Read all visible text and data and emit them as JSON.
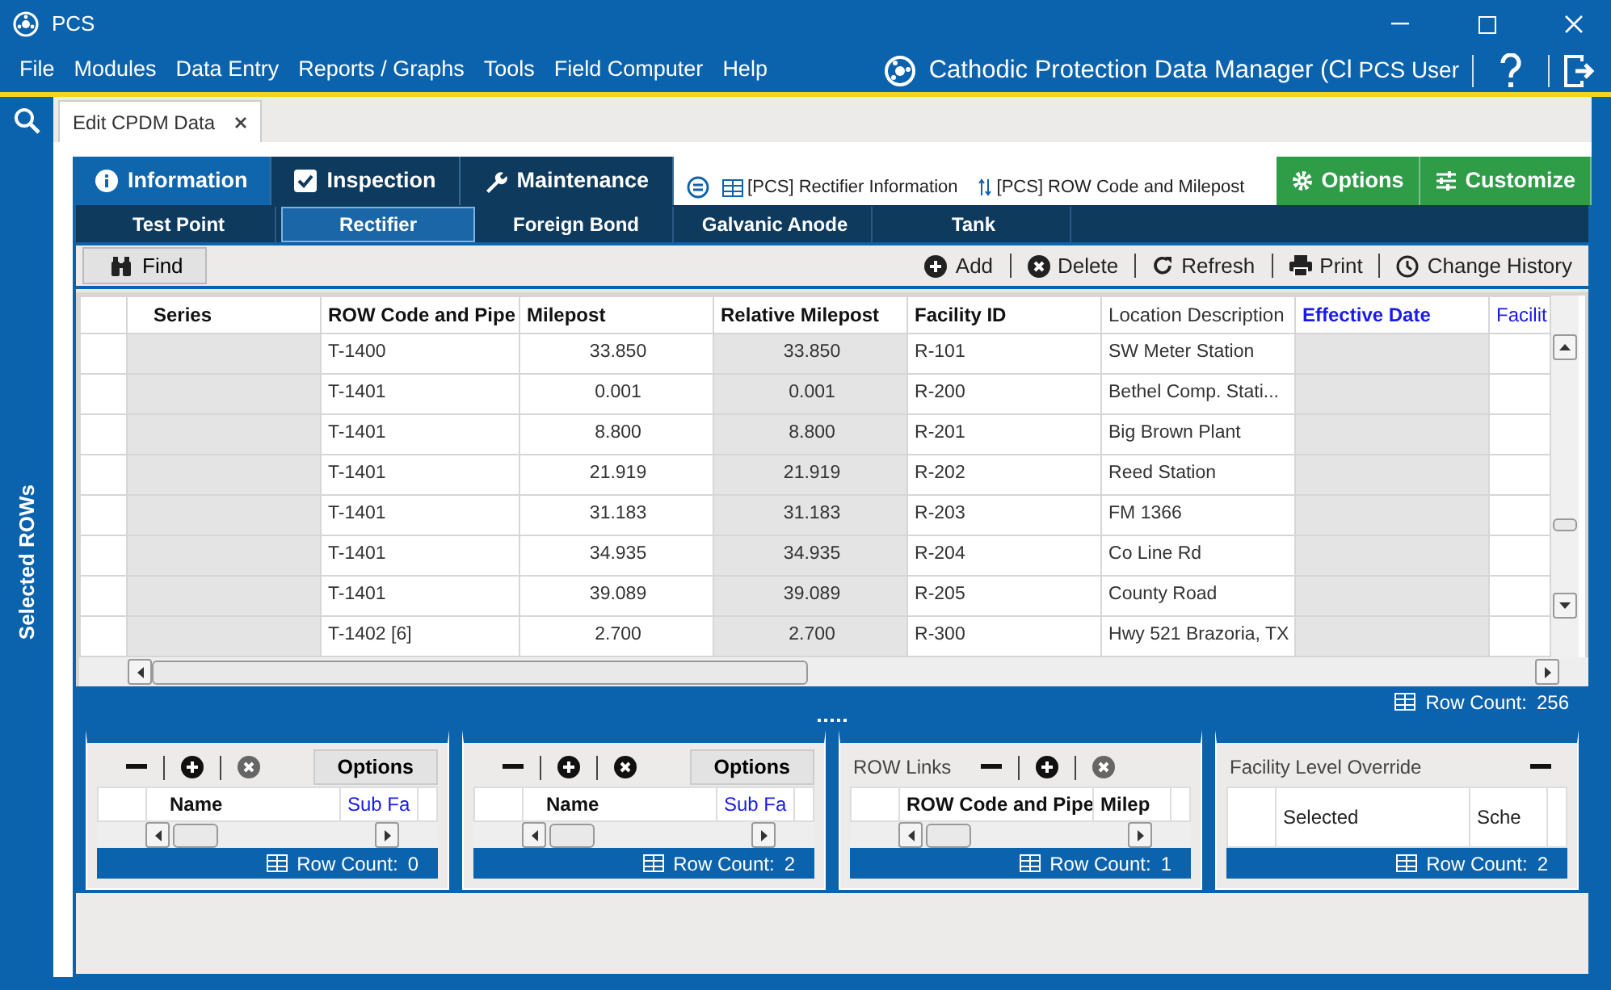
{
  "window": {
    "title": "PCS"
  },
  "menu": [
    "File",
    "Modules",
    "Data Entry",
    "Reports / Graphs",
    "Tools",
    "Field Computer",
    "Help"
  ],
  "app_title": "Cathodic Protection Data Manager (Cl",
  "user": "PCS User",
  "sidebar": {
    "label": "Selected ROWs"
  },
  "doc_tabs": [
    {
      "label": "Edit CPDM Data",
      "selected": true
    }
  ],
  "module_tabs": [
    {
      "label": "Information",
      "selected": true
    },
    {
      "label": "Inspection",
      "selected": false
    },
    {
      "label": "Maintenance",
      "selected": false
    }
  ],
  "links": [
    "[PCS] Rectifier Information",
    "[PCS] ROW Code and Milepost"
  ],
  "action_buttons": [
    "Options",
    "Customize"
  ],
  "sub_tabs": [
    {
      "label": "Test Point",
      "selected": false
    },
    {
      "label": "Rectifier",
      "selected": true
    },
    {
      "label": "Foreign Bond",
      "selected": false
    },
    {
      "label": "Galvanic Anode",
      "selected": false
    },
    {
      "label": "Tank",
      "selected": false
    }
  ],
  "toolbar": {
    "find": "Find",
    "actions": [
      "Add",
      "Delete",
      "Refresh",
      "Print",
      "Change History"
    ]
  },
  "table": {
    "columns": [
      {
        "label": "Series",
        "kind": "bold",
        "shaded": true
      },
      {
        "label": "ROW Code and Pipe",
        "kind": "bold",
        "shaded": false
      },
      {
        "label": "Milepost",
        "kind": "bold",
        "shaded": false
      },
      {
        "label": "Relative Milepost",
        "kind": "bold",
        "shaded": true
      },
      {
        "label": "Facility ID",
        "kind": "bold",
        "shaded": false
      },
      {
        "label": "Location Description",
        "kind": "plain",
        "shaded": false
      },
      {
        "label": "Effective Date",
        "kind": "link_bold",
        "shaded": true
      },
      {
        "label": "Facilit",
        "kind": "link",
        "shaded": false
      }
    ],
    "rows": [
      [
        null,
        "T-1400",
        "33.850",
        "33.850",
        "R-101",
        "SW Meter Station",
        null,
        null
      ],
      [
        null,
        "T-1401",
        "0.001",
        "0.001",
        "R-200",
        "Bethel Comp. Stati...",
        null,
        null
      ],
      [
        null,
        "T-1401",
        "8.800",
        "8.800",
        "R-201",
        "Big Brown Plant",
        null,
        null
      ],
      [
        null,
        "T-1401",
        "21.919",
        "21.919",
        "R-202",
        "Reed Station",
        null,
        null
      ],
      [
        null,
        "T-1401",
        "31.183",
        "31.183",
        "R-203",
        "FM 1366",
        null,
        null
      ],
      [
        null,
        "T-1401",
        "34.935",
        "34.935",
        "R-204",
        "Co Line Rd",
        null,
        null
      ],
      [
        null,
        "T-1401",
        "39.089",
        "39.089",
        "R-205",
        "County Road",
        null,
        null
      ],
      [
        null,
        "T-1402 [6]",
        "2.700",
        "2.700",
        "R-300",
        "Hwy 521 Brazoria, TX",
        null,
        null
      ]
    ],
    "row_count_label": "Row Count:",
    "row_count": "256"
  },
  "panels": [
    {
      "tools": [
        {
          "kind": "remove",
          "disabled": false
        },
        {
          "kind": "add",
          "disabled": false
        },
        {
          "kind": "delete",
          "disabled": true
        }
      ],
      "options": "Options",
      "columns": [
        {
          "label": "Name",
          "kind": "bold"
        },
        {
          "label": "Sub Fa",
          "kind": "link"
        }
      ],
      "row_count_label": "Row Count:",
      "row_count": "0"
    },
    {
      "tools": [
        {
          "kind": "remove",
          "disabled": false
        },
        {
          "kind": "add",
          "disabled": false
        },
        {
          "kind": "delete",
          "disabled": false
        }
      ],
      "options": "Options",
      "columns": [
        {
          "label": "Name",
          "kind": "bold"
        },
        {
          "label": "Sub Fa",
          "kind": "link"
        }
      ],
      "row_count_label": "Row Count:",
      "row_count": "2"
    },
    {
      "title": "ROW Links",
      "tools": [
        {
          "kind": "remove",
          "disabled": false
        },
        {
          "kind": "add",
          "disabled": false
        },
        {
          "kind": "delete",
          "disabled": true
        }
      ],
      "columns": [
        {
          "label": "ROW Code and Pipe",
          "kind": "bold"
        },
        {
          "label": "Milep",
          "kind": "bold"
        }
      ],
      "row_count_label": "Row Count:",
      "row_count": "1"
    },
    {
      "title": "Facility Level Override",
      "tools": [
        {
          "kind": "remove",
          "disabled": false
        }
      ],
      "columns": [
        {
          "label": "Selected",
          "kind": "plain"
        },
        {
          "label": "Sche",
          "kind": "plain"
        }
      ],
      "row_count_label": "Row Count:",
      "row_count": "2"
    }
  ]
}
